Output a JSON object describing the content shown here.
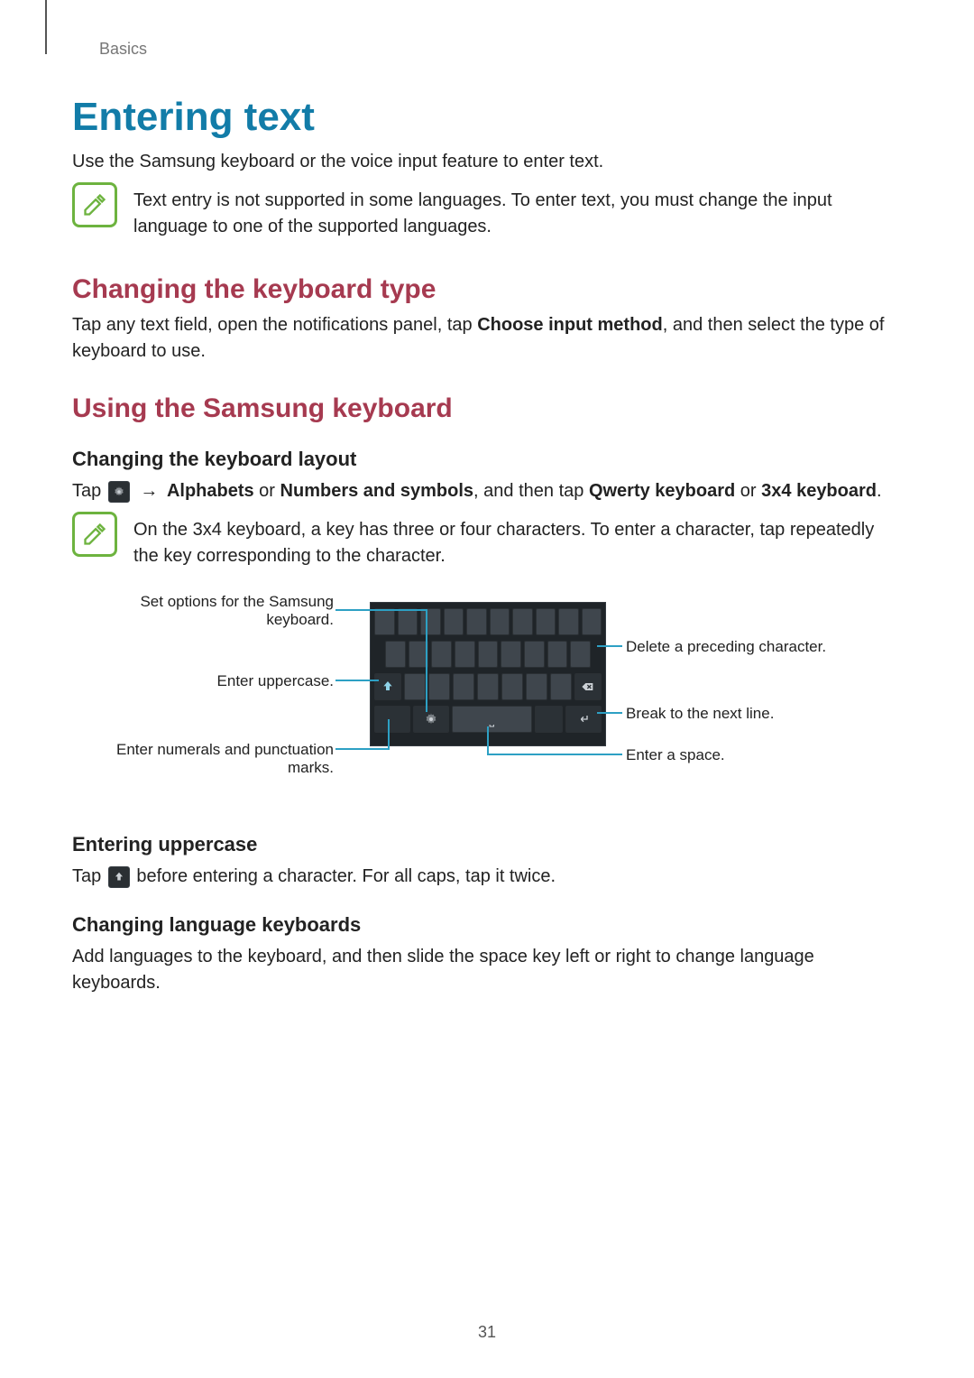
{
  "breadcrumb": "Basics",
  "page_number": "31",
  "h1": "Entering text",
  "intro": "Use the Samsung keyboard or the voice input feature to enter text.",
  "note1": "Text entry is not supported in some languages. To enter text, you must change the input language to one of the supported languages.",
  "h2a": "Changing the keyboard type",
  "p2a_pre": "Tap any text field, open the notifications panel, tap ",
  "p2a_bold": "Choose input method",
  "p2a_post": ", and then select the type of keyboard to use.",
  "h2b": "Using the Samsung keyboard",
  "h3a": "Changing the keyboard layout",
  "p3a_tap": "Tap ",
  "p3a_arrow": "→",
  "p3a_b1": "Alphabets",
  "p3a_or": " or ",
  "p3a_b2": "Numbers and symbols",
  "p3a_mid": ", and then tap ",
  "p3a_b3": "Qwerty keyboard",
  "p3a_or2": " or ",
  "p3a_b4": "3x4 keyboard",
  "p3a_end": ".",
  "note2": "On the 3x4 keyboard, a key has three or four characters. To enter a character, tap repeatedly the key corresponding to the character.",
  "callouts": {
    "set_options": "Set options for the Samsung keyboard.",
    "uppercase": "Enter uppercase.",
    "numerals": "Enter numerals and punctuation marks.",
    "delete": "Delete a preceding character.",
    "nextline": "Break to the next line.",
    "space": "Enter a space."
  },
  "h3b": "Entering uppercase",
  "p3b_pre": "Tap ",
  "p3b_post": " before entering a character. For all caps, tap it twice.",
  "h3c": "Changing language keyboards",
  "p3c": "Add languages to the keyboard, and then slide the space key left or right to change language keyboards."
}
